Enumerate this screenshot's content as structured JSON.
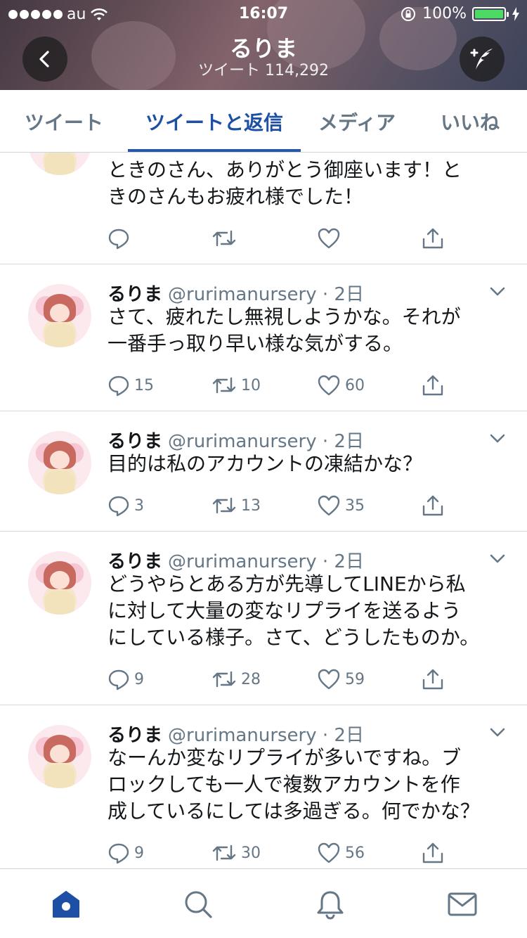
{
  "status_bar": {
    "carrier": "au",
    "time": "16:07",
    "battery": "100%"
  },
  "header": {
    "name": "るりま",
    "tweet_count": "ツイート 114,292",
    "back_icon": "chevron-left-icon",
    "compose_icon": "compose-tweet-icon"
  },
  "tabs": [
    {
      "label": "ツイート",
      "active": false
    },
    {
      "label": "ツイートと返信",
      "active": true
    },
    {
      "label": "メディア",
      "active": false
    },
    {
      "label": "いいね",
      "active": false
    }
  ],
  "tweets": [
    {
      "name": "",
      "handle": "",
      "text_lines": [
        "ときのさん、ありがとう御座います！と",
        "きのさんもお疲れ様でした！"
      ],
      "replies": "",
      "retweets": "",
      "likes": ""
    },
    {
      "name": "るりま",
      "handle": "@rurimanursery · 2日",
      "text_lines": [
        "さて、疲れたし無視しようかな。それが",
        "一番手っ取り早い様な気がする。"
      ],
      "replies": "15",
      "retweets": "10",
      "likes": "60"
    },
    {
      "name": "るりま",
      "handle": "@rurimanursery · 2日",
      "text_lines": [
        "目的は私のアカウントの凍結かな？"
      ],
      "replies": "3",
      "retweets": "13",
      "likes": "35"
    },
    {
      "name": "るりま",
      "handle": "@rurimanursery · 2日",
      "text_lines": [
        "どうやらとある方が先導してLINEから私",
        "に対して大量の変なリプライを送るよう",
        "にしている様子。さて、どうしたものか。"
      ],
      "replies": "9",
      "retweets": "28",
      "likes": "59"
    },
    {
      "name": "るりま",
      "handle": "@rurimanursery · 2日",
      "text_lines": [
        "なーんか変なリプライが多いですね。ブ",
        "ロックしても一人で複数アカウントを作",
        "成しているにしては多過ぎる。何でかな？"
      ],
      "replies": "9",
      "retweets": "30",
      "likes": "56"
    }
  ],
  "bottom_nav": [
    {
      "icon": "home-icon",
      "active": true
    },
    {
      "icon": "search-icon",
      "active": false
    },
    {
      "icon": "notifications-bell-icon",
      "active": false
    },
    {
      "icon": "messages-envelope-icon",
      "active": false
    }
  ],
  "colors": {
    "accent": "#1d50a5",
    "muted": "#657786",
    "battery_green": "#4cd964"
  }
}
